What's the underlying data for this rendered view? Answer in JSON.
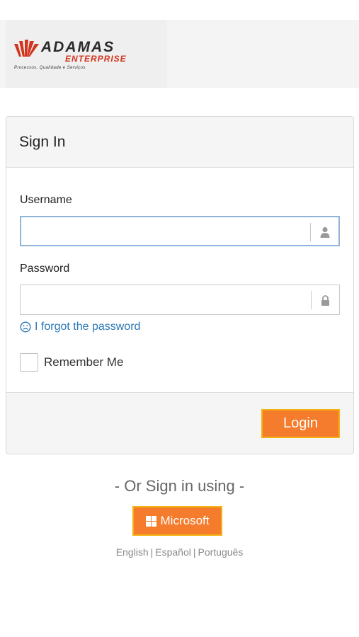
{
  "brand": {
    "name": "ADAMAS",
    "sub": "ENTERPRISE",
    "tagline": "Processos, Qualidade e Serviços",
    "accent_color": "#d2351e"
  },
  "login": {
    "title": "Sign In",
    "username_label": "Username",
    "username_value": "",
    "password_label": "Password",
    "password_value": "",
    "forgot_label": "I forgot the password",
    "remember_label": "Remember Me",
    "login_button": "Login"
  },
  "alt_login": {
    "or_text": "- Or Sign in using -",
    "microsoft_button": "Microsoft"
  },
  "languages": [
    "English",
    "Español",
    "Português"
  ],
  "colors": {
    "button_bg": "#f47c2c",
    "button_border": "#f5b312",
    "link": "#2a77b5"
  }
}
